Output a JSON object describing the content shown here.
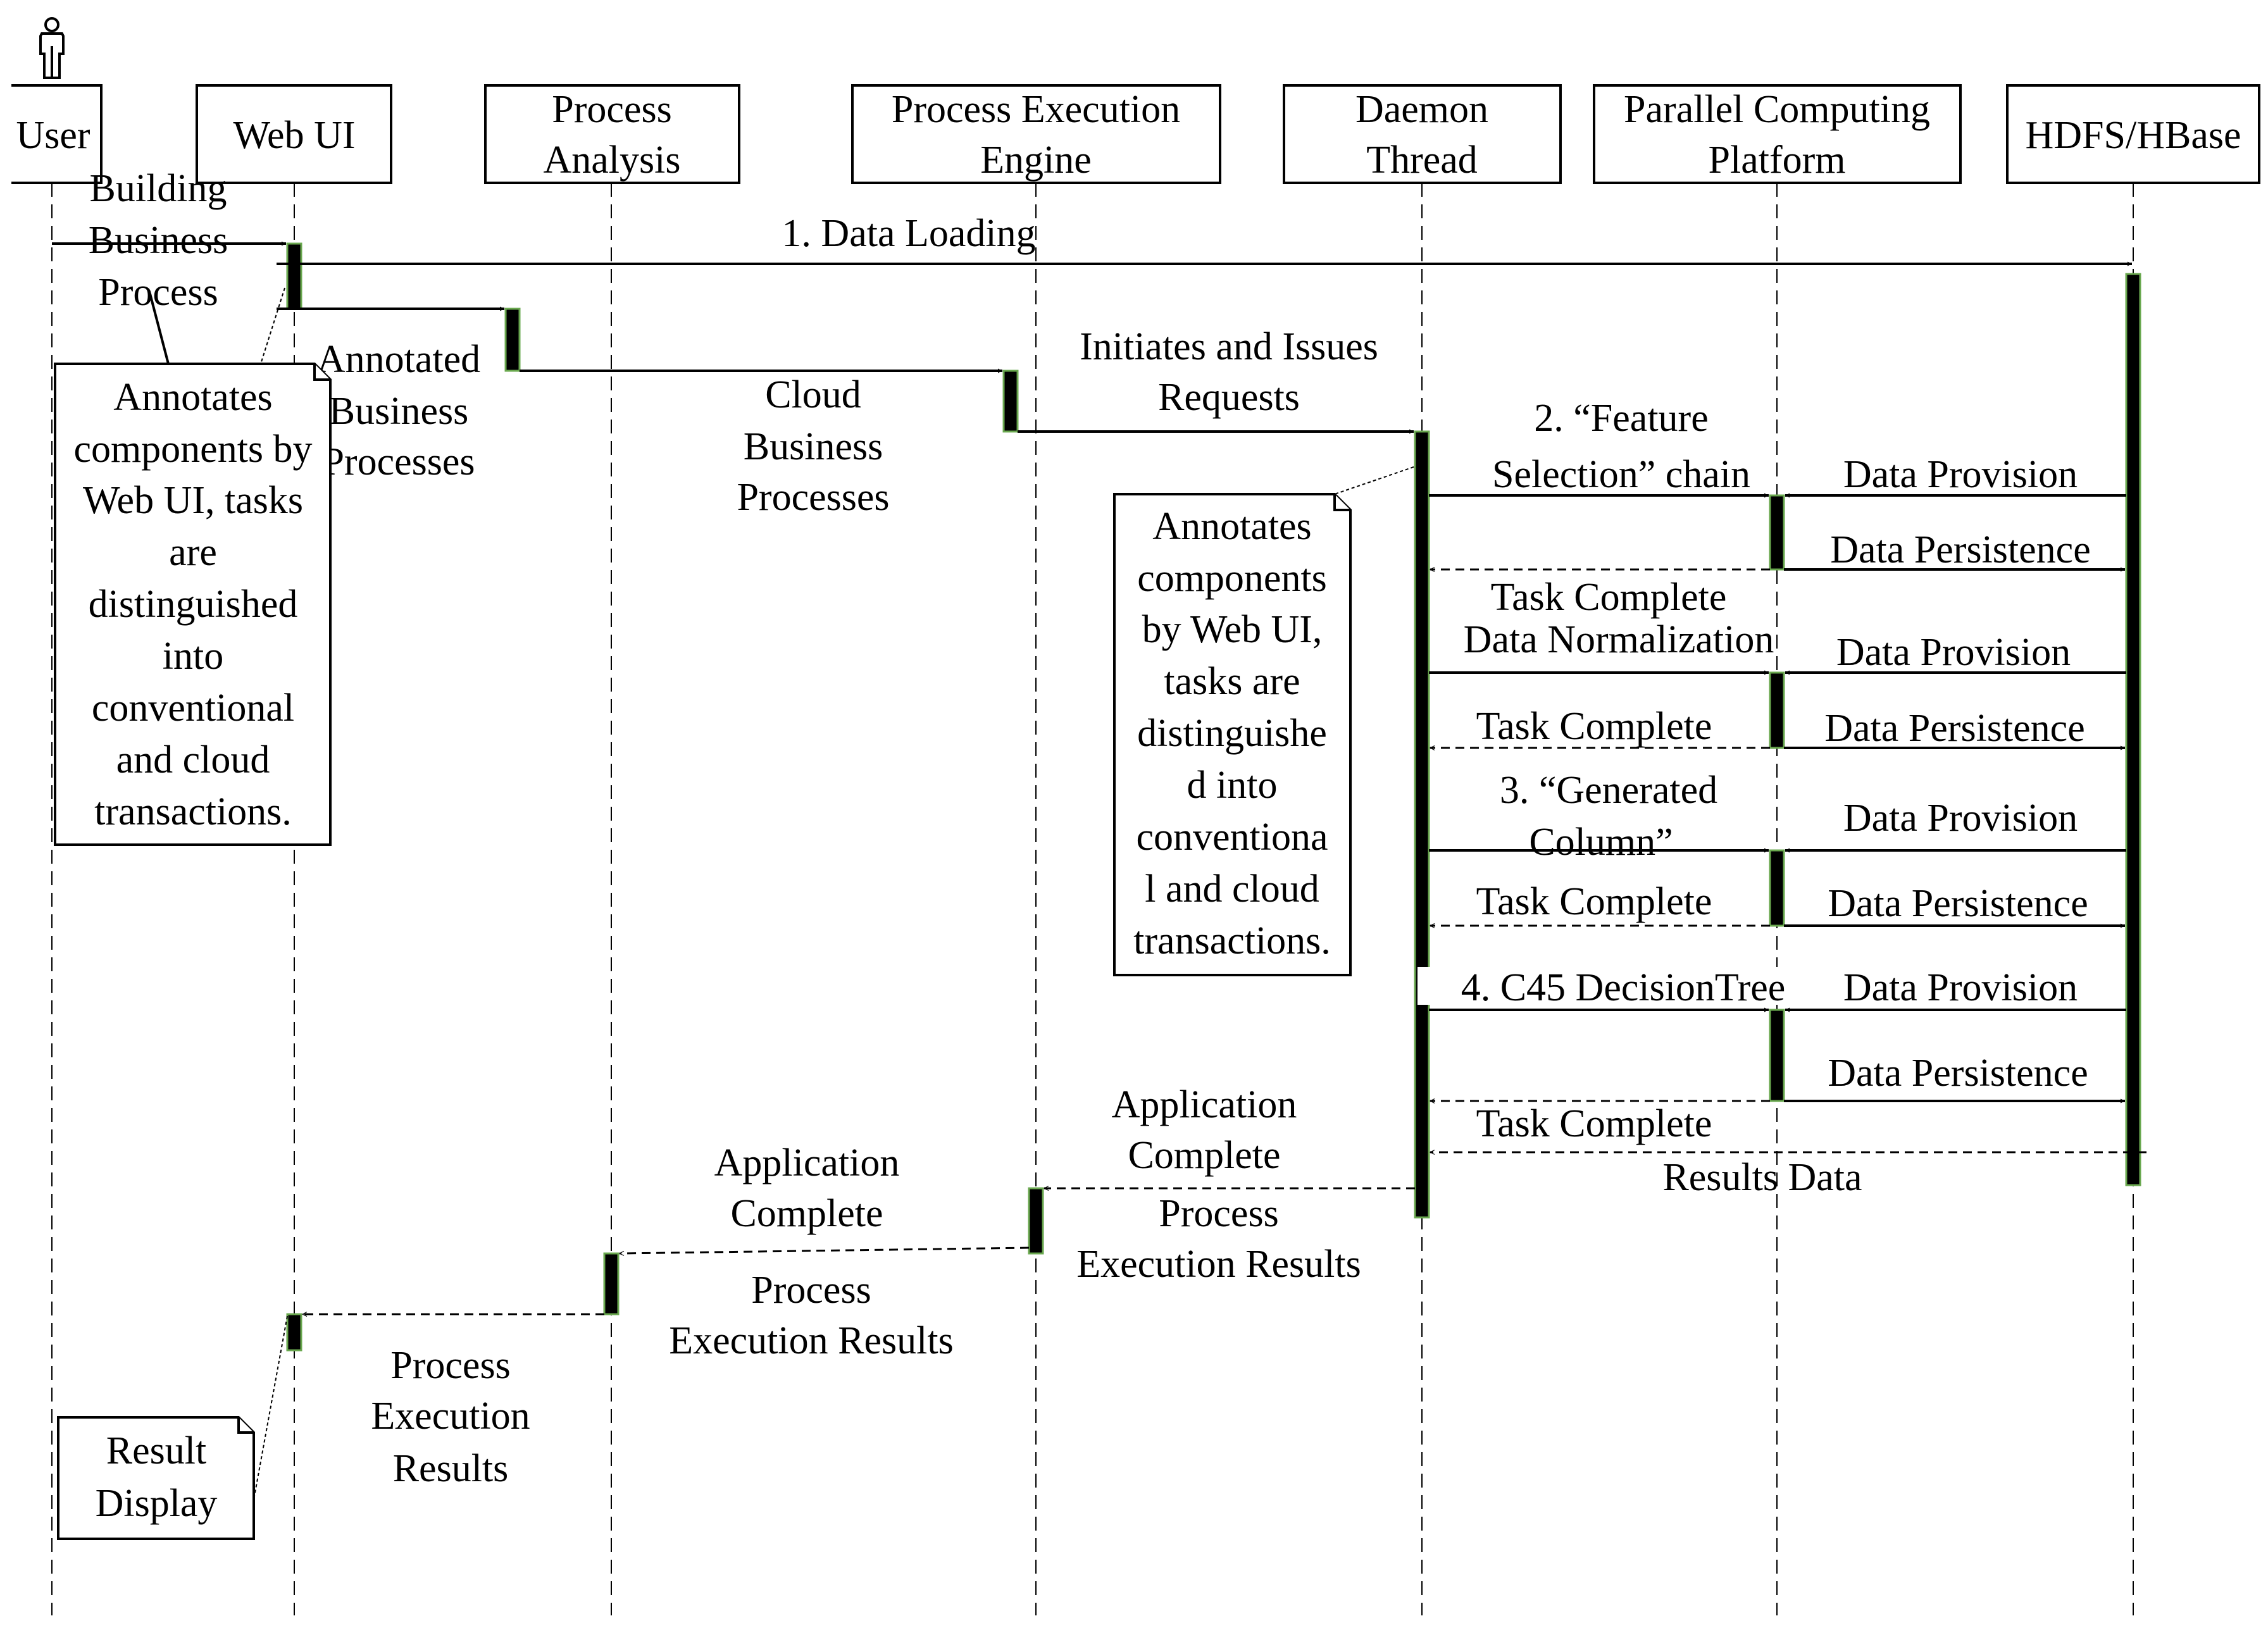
{
  "diagram": {
    "type": "sequence",
    "actor_icon": "person-icon",
    "colors": {
      "line": "#000000",
      "activation_fill": "#000000",
      "activation_border": "#6aa84f",
      "background": "#ffffff"
    },
    "participants": [
      {
        "id": "user",
        "lines": [
          "User"
        ]
      },
      {
        "id": "webui",
        "lines": [
          "Web UI"
        ]
      },
      {
        "id": "pa",
        "lines": [
          "Process",
          "Analysis"
        ]
      },
      {
        "id": "pee",
        "lines": [
          "Process Execution",
          "Engine"
        ]
      },
      {
        "id": "daemon",
        "lines": [
          "Daemon",
          "Thread"
        ]
      },
      {
        "id": "pcp",
        "lines": [
          "Parallel Computing",
          "Platform"
        ]
      },
      {
        "id": "hdfs",
        "lines": [
          "HDFS/HBase"
        ]
      }
    ],
    "messages": [
      {
        "from": "user",
        "to": "webui",
        "style": "sync",
        "lines": [
          "Building",
          "Business",
          "Process"
        ]
      },
      {
        "from": "webui",
        "to": "hdfs",
        "style": "sync",
        "lines": [
          "1. Data Loading"
        ]
      },
      {
        "from": "webui",
        "to": "pa",
        "style": "sync",
        "lines": [
          "Annotated",
          "Business",
          "Processes"
        ]
      },
      {
        "from": "pa",
        "to": "pee",
        "style": "sync",
        "lines": [
          "Cloud",
          "Business",
          "Processes"
        ]
      },
      {
        "from": "pee",
        "to": "daemon",
        "style": "sync",
        "lines": [
          "Initiates and Issues",
          "Requests"
        ]
      },
      {
        "from": "daemon",
        "to": "pcp",
        "style": "sync",
        "lines": [
          "2. “Feature",
          "Selection” chain"
        ]
      },
      {
        "from": "hdfs",
        "to": "pcp",
        "style": "sync",
        "lines": [
          "Data  Provision"
        ]
      },
      {
        "from": "pcp",
        "to": "hdfs",
        "style": "sync",
        "lines": [
          "Data Persistence"
        ]
      },
      {
        "from": "pcp",
        "to": "daemon",
        "style": "return",
        "lines": [
          "Task Complete"
        ]
      },
      {
        "from": "daemon",
        "to": "pcp",
        "style": "sync",
        "lines": [
          "Data Normalization"
        ]
      },
      {
        "from": "hdfs",
        "to": "pcp",
        "style": "sync",
        "lines": [
          "Data  Provision"
        ]
      },
      {
        "from": "pcp",
        "to": "hdfs",
        "style": "sync",
        "lines": [
          "Data Persistence"
        ]
      },
      {
        "from": "pcp",
        "to": "daemon",
        "style": "return",
        "lines": [
          "Task Complete"
        ]
      },
      {
        "from": "daemon",
        "to": "pcp",
        "style": "sync",
        "lines": [
          "3. “Generated",
          "Column”"
        ]
      },
      {
        "from": "hdfs",
        "to": "pcp",
        "style": "sync",
        "lines": [
          "Data  Provision"
        ]
      },
      {
        "from": "pcp",
        "to": "hdfs",
        "style": "sync",
        "lines": [
          "Data Persistence"
        ]
      },
      {
        "from": "pcp",
        "to": "daemon",
        "style": "return",
        "lines": [
          "Task Complete"
        ]
      },
      {
        "from": "daemon",
        "to": "pcp",
        "style": "sync",
        "lines": [
          "4. C45 DecisionTree"
        ]
      },
      {
        "from": "hdfs",
        "to": "pcp",
        "style": "sync",
        "lines": [
          "Data  Provision"
        ]
      },
      {
        "from": "pcp",
        "to": "hdfs",
        "style": "sync",
        "lines": [
          "Data Persistence"
        ]
      },
      {
        "from": "pcp",
        "to": "daemon",
        "style": "return",
        "lines": [
          "Task Complete"
        ]
      },
      {
        "from": "hdfs",
        "to": "daemon",
        "style": "return",
        "lines": [
          "Results Data"
        ]
      },
      {
        "from": "daemon",
        "to": "pee",
        "style": "return",
        "lines": [
          "Application",
          "Complete"
        ],
        "lines_below": [
          "Process",
          "Execution Results"
        ]
      },
      {
        "from": "pee",
        "to": "pa",
        "style": "return",
        "lines": [
          "Application",
          "Complete"
        ],
        "lines_below": [
          "Process",
          "Execution Results"
        ]
      },
      {
        "from": "pa",
        "to": "webui",
        "style": "return",
        "lines": [
          "Process",
          "Execution",
          "Results"
        ]
      }
    ],
    "notes": [
      {
        "id": "note-webui",
        "attached_to": "webui",
        "lines": [
          "Annotates",
          "components by",
          "Web UI, tasks",
          "are",
          "distinguished",
          "into",
          "conventional",
          "and cloud",
          "transactions."
        ]
      },
      {
        "id": "note-daemon",
        "attached_to": "daemon",
        "lines": [
          "Annotates",
          "components",
          "by Web UI,",
          "tasks are",
          "distinguishe",
          "d into",
          "conventiona",
          "l and cloud",
          "transactions."
        ]
      },
      {
        "id": "note-result",
        "attached_to": "webui",
        "lines": [
          "Result",
          "Display"
        ]
      }
    ]
  }
}
